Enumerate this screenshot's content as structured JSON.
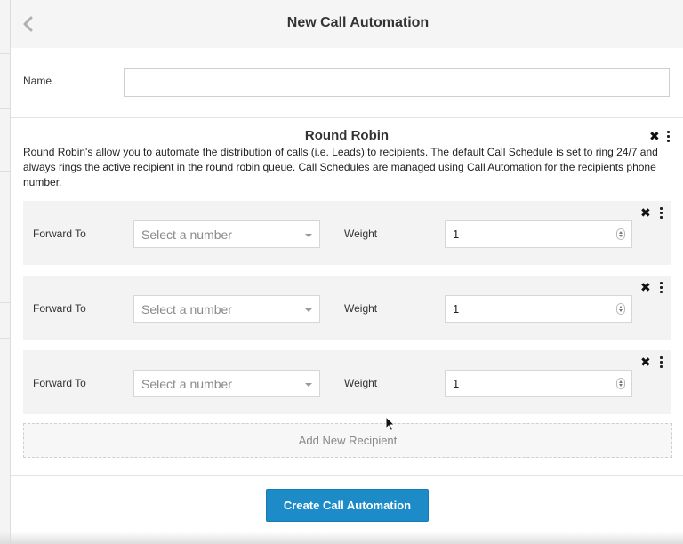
{
  "header": {
    "title": "New Call Automation",
    "back_icon": "chevron-left-icon"
  },
  "name_field": {
    "label": "Name",
    "value": "",
    "placeholder": ""
  },
  "round_robin": {
    "title": "Round Robin",
    "description": "Round Robin's allow you to automate the distribution of calls (i.e. Leads) to recipients. The default Call Schedule is set to ring 24/7 and always rings the active recipient in the round robin queue. Call Schedules are managed using Call Automation for the recipients phone number.",
    "recipients": [
      {
        "forward_label": "Forward To",
        "forward_placeholder": "Select a number",
        "weight_label": "Weight",
        "weight_value": "1"
      },
      {
        "forward_label": "Forward To",
        "forward_placeholder": "Select a number",
        "weight_label": "Weight",
        "weight_value": "1"
      },
      {
        "forward_label": "Forward To",
        "forward_placeholder": "Select a number",
        "weight_label": "Weight",
        "weight_value": "1"
      }
    ],
    "add_recipient_label": "Add New Recipient"
  },
  "actions": {
    "create_label": "Create Call Automation"
  },
  "colors": {
    "primary_button": "#1c8bc7",
    "header_bg": "#f5f5f5",
    "recipient_bg": "#f3f3f3"
  }
}
